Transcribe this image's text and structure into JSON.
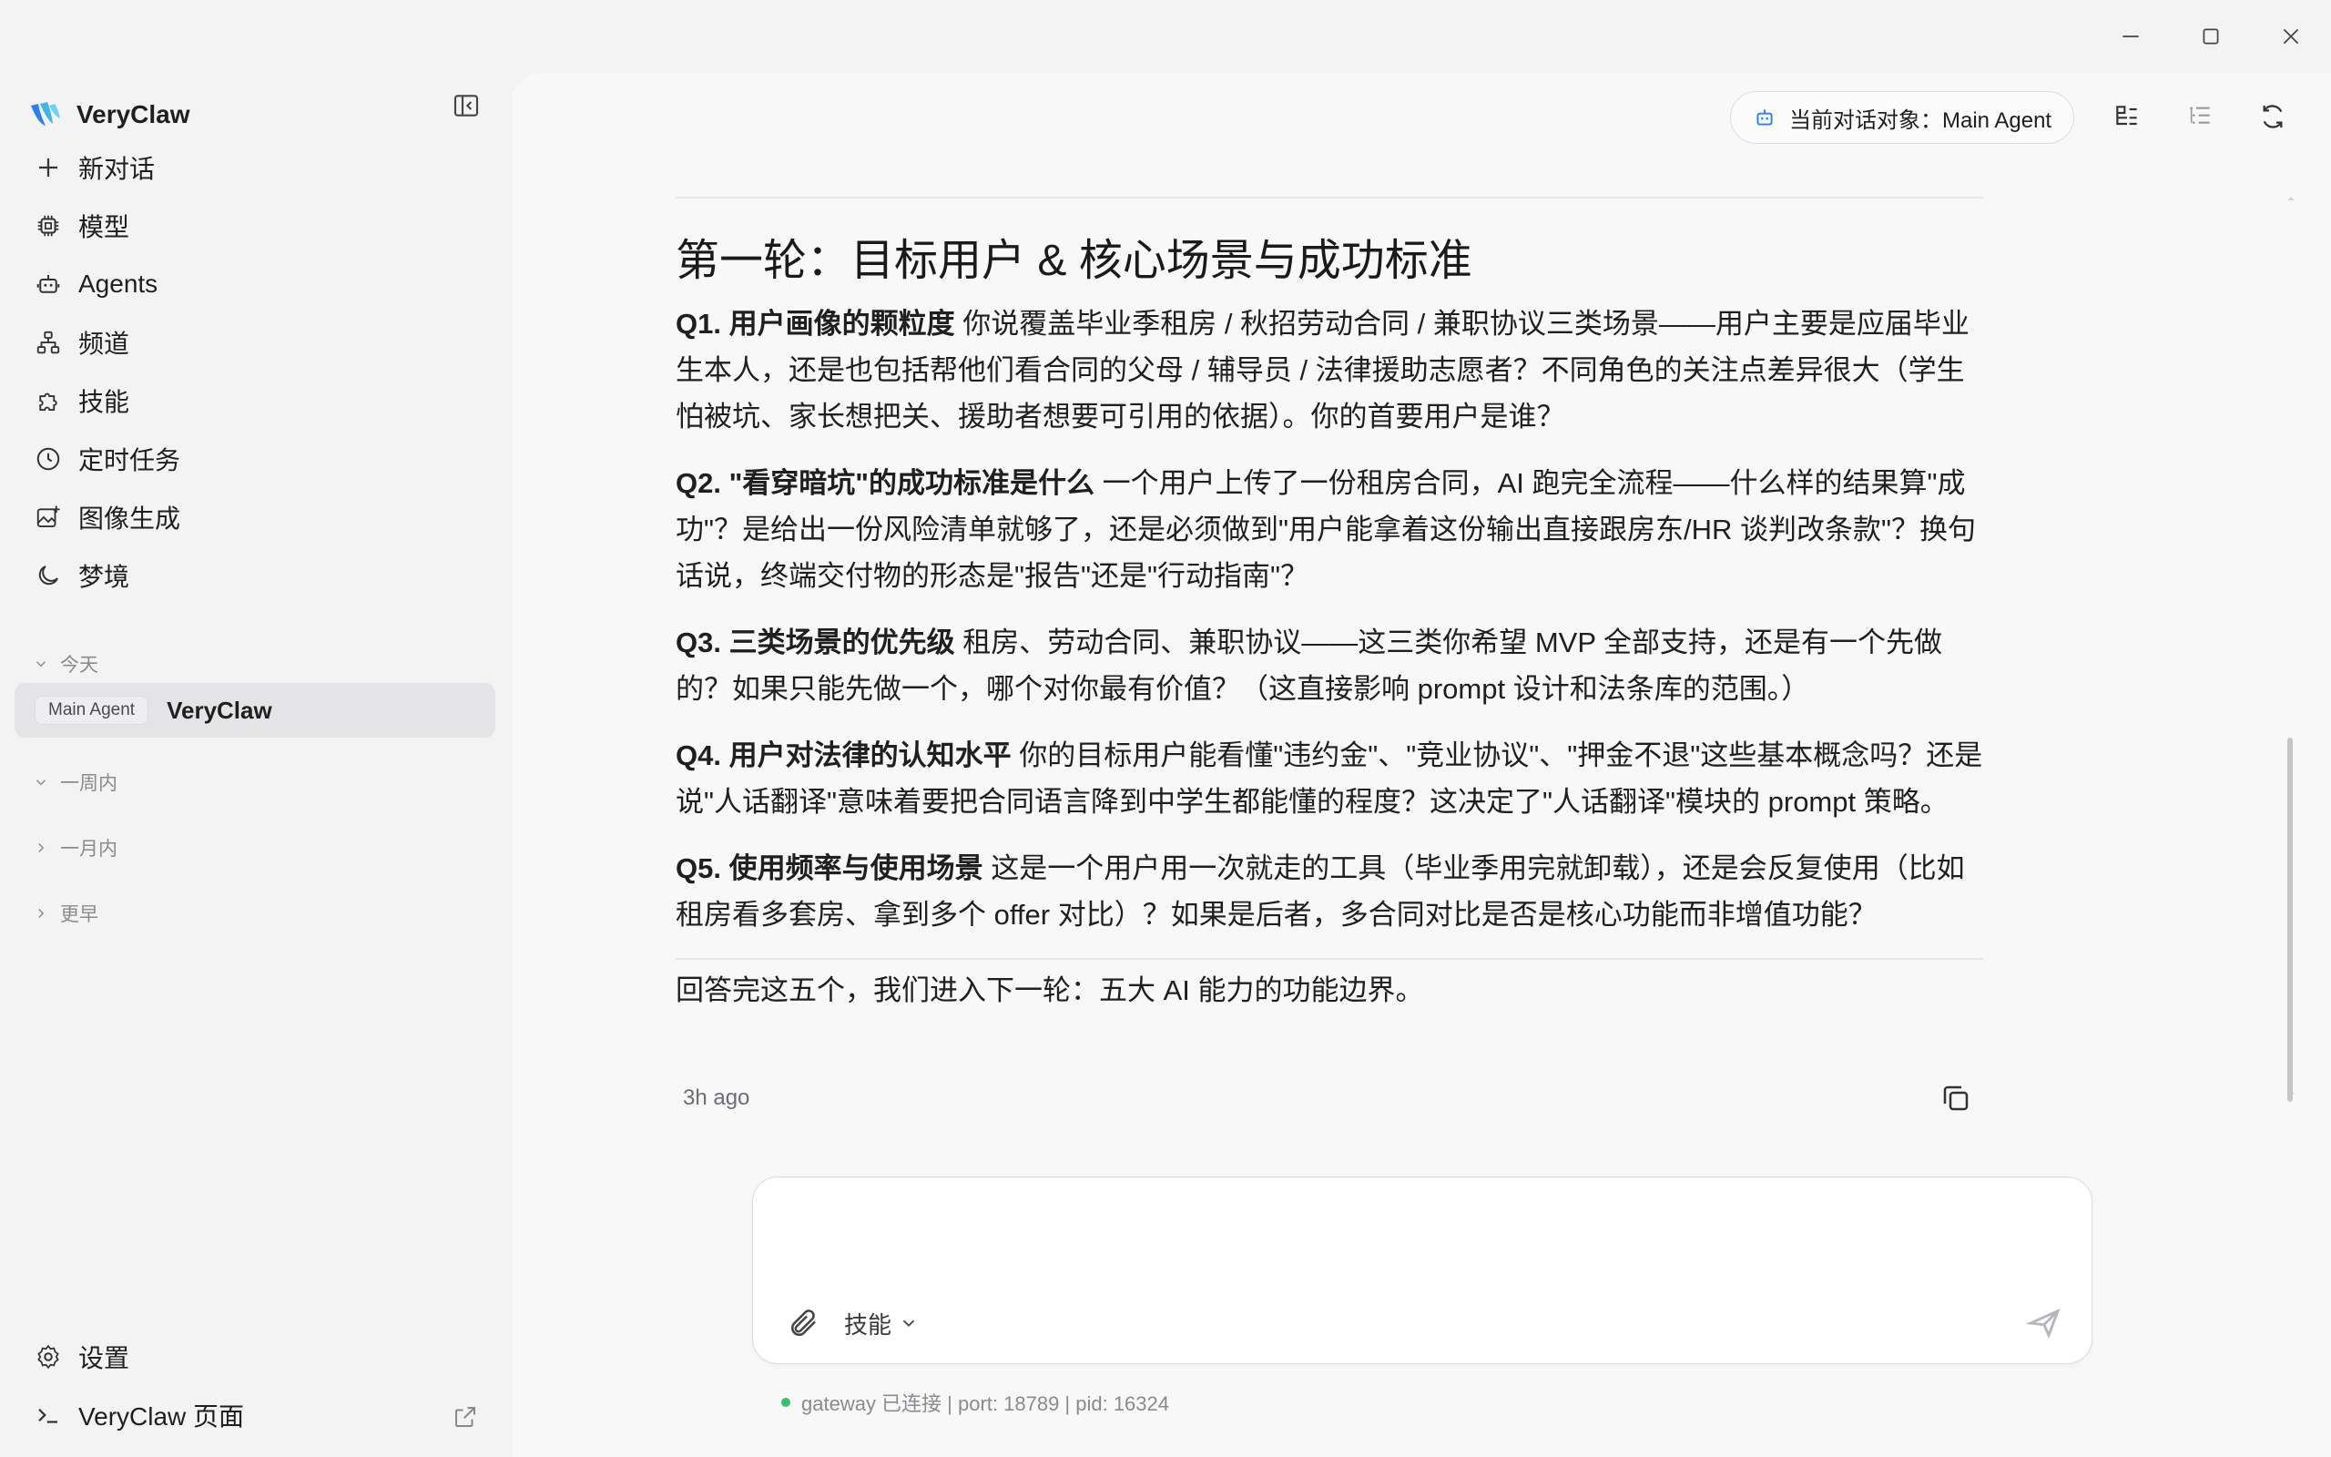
{
  "window": {
    "controls": [
      "minimize",
      "maximize",
      "close"
    ]
  },
  "sidebar": {
    "brand": "VeryClaw",
    "nav": [
      {
        "label": "新对话",
        "icon": "plus-icon"
      },
      {
        "label": "模型",
        "icon": "chip-icon"
      },
      {
        "label": "Agents",
        "icon": "robot-icon"
      },
      {
        "label": "频道",
        "icon": "network-icon"
      },
      {
        "label": "技能",
        "icon": "puzzle-icon"
      },
      {
        "label": "定时任务",
        "icon": "clock-icon"
      },
      {
        "label": "图像生成",
        "icon": "image-plus-icon"
      },
      {
        "label": "梦境",
        "icon": "moon-icon"
      }
    ],
    "groups": {
      "today": "今天",
      "week": "一周内",
      "month": "一月内",
      "earlier": "更早"
    },
    "session": {
      "badge": "Main Agent",
      "name": "VeryClaw"
    },
    "bottom": {
      "settings": "设置",
      "page": "VeryClaw 页面"
    }
  },
  "header": {
    "agent_pill": "当前对话对象：Main Agent"
  },
  "message": {
    "heading": "第一轮：目标用户 & 核心场景与成功标准",
    "questions": [
      {
        "title": "Q1. 用户画像的颗粒度",
        "body": " 你说覆盖毕业季租房 / 秋招劳动合同 / 兼职协议三类场景——用户主要是应届毕业生本人，还是也包括帮他们看合同的父母 / 辅导员 / 法律援助志愿者？不同角色的关注点差异很大（学生怕被坑、家长想把关、援助者想要可引用的依据）。你的首要用户是谁？"
      },
      {
        "title": "Q2. \"看穿暗坑\"的成功标准是什么",
        "body": " 一个用户上传了一份租房合同，AI 跑完全流程——什么样的结果算\"成功\"？是给出一份风险清单就够了，还是必须做到\"用户能拿着这份输出直接跟房东/HR 谈判改条款\"？换句话说，终端交付物的形态是\"报告\"还是\"行动指南\"？"
      },
      {
        "title": "Q3. 三类场景的优先级",
        "body": " 租房、劳动合同、兼职协议——这三类你希望 MVP 全部支持，还是有一个先做的？如果只能先做一个，哪个对你最有价值？（这直接影响 prompt 设计和法条库的范围。）"
      },
      {
        "title": "Q4. 用户对法律的认知水平",
        "body": " 你的目标用户能看懂\"违约金\"、\"竞业协议\"、\"押金不退\"这些基本概念吗？还是说\"人话翻译\"意味着要把合同语言降到中学生都能懂的程度？这决定了\"人话翻译\"模块的 prompt 策略。"
      },
      {
        "title": "Q5. 使用频率与使用场景",
        "body": " 这是一个用户用一次就走的工具（毕业季用完就卸载），还是会反复使用（比如租房看多套房、拿到多个 offer 对比）？如果是后者，多合同对比是否是核心功能而非增值功能？"
      }
    ],
    "closing": "回答完这五个，我们进入下一轮：五大 AI 能力的功能边界。",
    "time": "3h ago"
  },
  "composer": {
    "placeholder": "",
    "skills_label": "技能"
  },
  "status": {
    "text": "gateway 已连接 | port: 18789 | pid: 16324"
  },
  "colors": {
    "accent": "#2f80ed",
    "status_ok": "#34c26a"
  }
}
